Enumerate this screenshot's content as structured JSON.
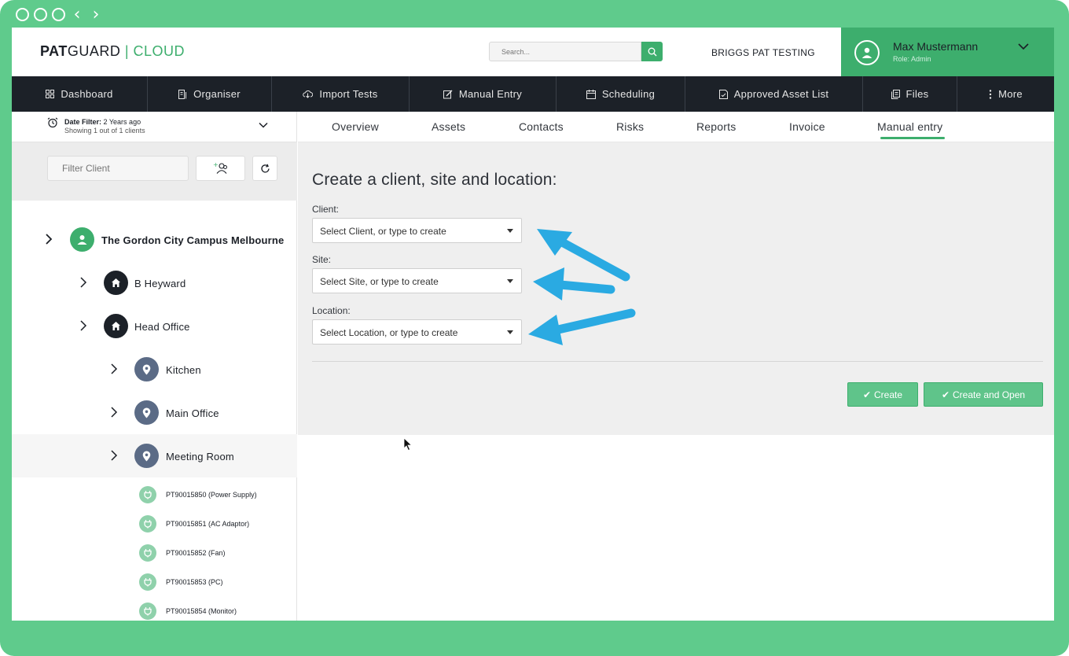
{
  "header": {
    "logo_pat": "PAT",
    "logo_guard": "GUARD",
    "logo_sep": " | ",
    "logo_cloud": "CLOUD",
    "search_placeholder": "Search...",
    "company": "BRIGGS PAT TESTING",
    "user_name": "Max Mustermann",
    "user_role": "Role: Admin"
  },
  "nav": [
    {
      "label": "Dashboard",
      "icon": "grid-icon"
    },
    {
      "label": "Organiser",
      "icon": "organiser-icon"
    },
    {
      "label": "Import Tests",
      "icon": "import-icon"
    },
    {
      "label": "Manual Entry",
      "icon": "edit-icon"
    },
    {
      "label": "Scheduling",
      "icon": "calendar-icon"
    },
    {
      "label": "Approved Asset List",
      "icon": "list-icon"
    },
    {
      "label": "Files",
      "icon": "files-icon"
    },
    {
      "label": "More",
      "icon": "more-icon"
    }
  ],
  "sidebar": {
    "date_filter_label": "Date Filter:",
    "date_filter_value": "2 Years ago",
    "showing": "Showing 1 out of 1 clients",
    "filter_placeholder": "Filter Client",
    "tree": {
      "client": "The Gordon City Campus Melbourne",
      "sites": [
        "B Heyward",
        "Head Office"
      ],
      "locations": [
        "Kitchen",
        "Main Office",
        "Meeting Room"
      ],
      "assets": [
        "PT90015850 (Power Supply)",
        "PT90015851 (AC Adaptor)",
        "PT90015852 (Fan)",
        "PT90015853 (PC)",
        "PT90015854 (Monitor)"
      ]
    }
  },
  "tabs": [
    "Overview",
    "Assets",
    "Contacts",
    "Risks",
    "Reports",
    "Invoice",
    "Manual entry"
  ],
  "form": {
    "title": "Create a client, site and location:",
    "client_label": "Client:",
    "client_placeholder": "Select Client, or type to create",
    "site_label": "Site:",
    "site_placeholder": "Select Site, or type to create",
    "location_label": "Location:",
    "location_placeholder": "Select Location, or type to create",
    "create_label": "Create",
    "create_open_label": "Create and Open"
  },
  "colors": {
    "brand_green": "#3dae6d",
    "frame_green": "#5fcb8c",
    "nav_dark": "#1c2128",
    "arrow_blue": "#2aaae2"
  }
}
